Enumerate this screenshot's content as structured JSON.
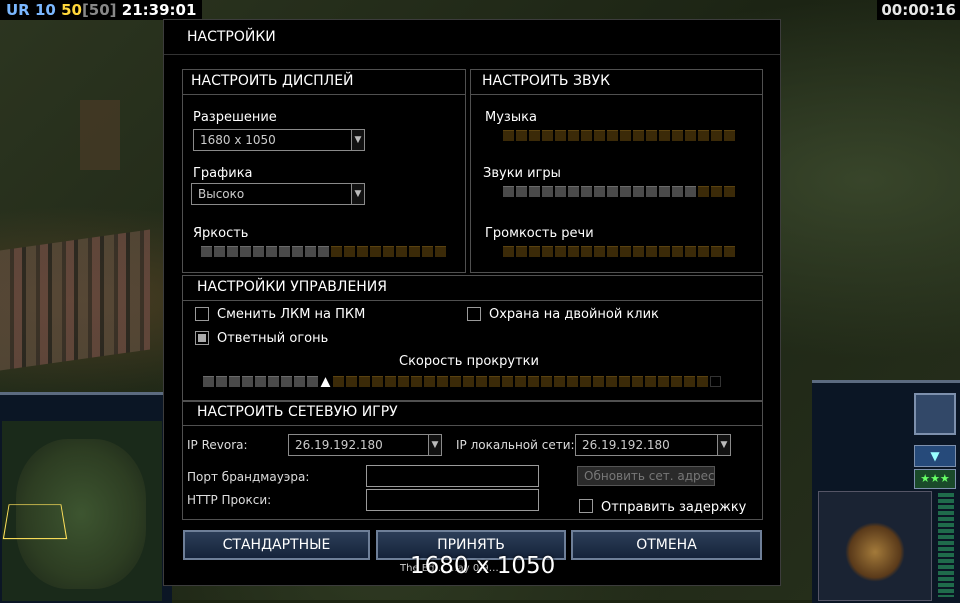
{
  "hud": {
    "faction": "UR",
    "supply_a": "10",
    "supply_b": "50",
    "supply_c": "[50]",
    "clock": "21:39:01",
    "timer": "00:00:16"
  },
  "dialog": {
    "title": "НАСТРОЙКИ",
    "display": {
      "title": "НАСТРОИТЬ ДИСПЛЕЙ",
      "resolution_label": "Разрешение",
      "resolution_value": "1680 x 1050",
      "graphics_label": "Графика",
      "graphics_value": "Высоко",
      "brightness_label": "Яркость",
      "brightness_level": 0.53
    },
    "sound": {
      "title": "НАСТРОИТЬ ЗВУК",
      "music_label": "Музыка",
      "music_level": 0.0,
      "sfx_label": "Звуки игры",
      "sfx_level": 0.85,
      "voice_label": "Громкость речи",
      "voice_level": 0.0
    },
    "controls": {
      "title": "НАСТРОЙКИ УПРАВЛЕНИЯ",
      "swap_mouse_label": "Сменить ЛКМ на ПКМ",
      "swap_mouse_checked": false,
      "double_click_guard_label": "Охрана на двойной клик",
      "double_click_guard_checked": false,
      "retaliation_label": "Ответный огонь",
      "retaliation_checked": true,
      "scroll_speed_label": "Скорость прокрутки",
      "scroll_speed_level": 0.22
    },
    "network": {
      "title": "НАСТРОИТЬ СЕТЕВУЮ ИГРУ",
      "revora_label": "IP Revora:",
      "revora_value": "26.19.192.180",
      "lan_label": "IP локальной сети:",
      "lan_value": "26.19.192.180",
      "firewall_label": "Порт брандмауэра:",
      "firewall_value": "",
      "proxy_label": "HTTP Прокси:",
      "proxy_value": "",
      "refresh_button": "Обновить сет. адрес",
      "send_delay_label": "Отправить задержку",
      "send_delay_checked": false
    },
    "buttons": {
      "default": "СТАНДАРТНЫЕ",
      "accept": "ПРИНЯТЬ",
      "cancel": "ОТМЕНА"
    },
    "footer_text": "The Ed… …ay 0.9…",
    "overlay_resolution": "1680 x 1050"
  },
  "colors": {
    "supply_yellow": "#ffd73a",
    "faction_blue": "#7bb8ff",
    "slider_on": "#4a4a4a",
    "slider_off": "#3b2a08",
    "button_blue": "#15233a"
  }
}
